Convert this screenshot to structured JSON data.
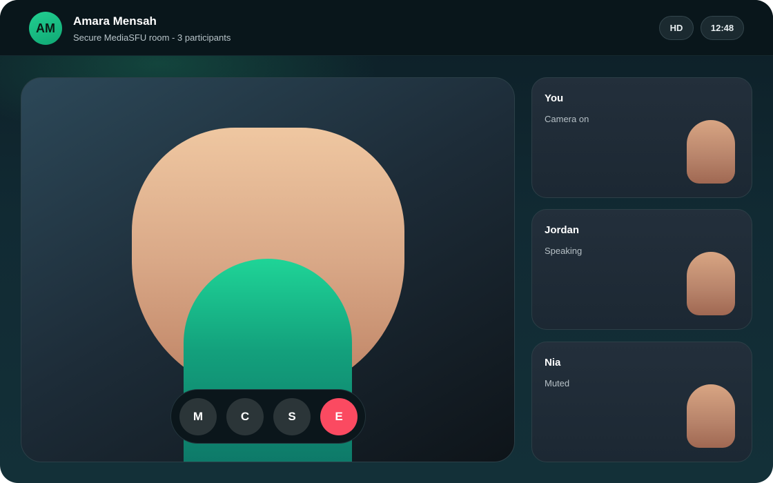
{
  "header": {
    "avatar_initials": "AM",
    "title": "Amara Mensah",
    "subtitle": "Secure MediaSFU room - 3 participants",
    "quality_badge": "HD",
    "time": "12:48"
  },
  "controls": {
    "mic_label": "M",
    "camera_label": "C",
    "share_label": "S",
    "end_label": "E"
  },
  "participants": [
    {
      "name": "You",
      "status": "Camera on"
    },
    {
      "name": "Jordan",
      "status": "Speaking"
    },
    {
      "name": "Nia",
      "status": "Muted"
    }
  ],
  "colors": {
    "accent": "#1ec88f",
    "end_call": "#fb4a61",
    "background": "#0d1e26"
  },
  "icons": {
    "avatar": "initials-avatar",
    "mic": "mic-icon",
    "camera": "camera-icon",
    "share": "screen-share-icon",
    "end": "end-call-icon"
  }
}
